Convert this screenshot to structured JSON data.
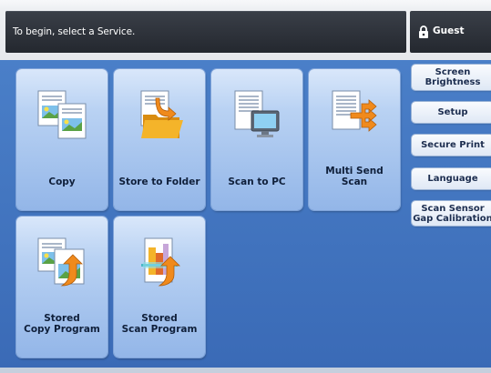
{
  "status": {
    "message": "To begin, select a Service.",
    "user_label": "Guest",
    "user_icon": "padlock-user-icon"
  },
  "services": [
    {
      "label_line1": "",
      "label_line2": "Copy",
      "icon": "copy-icon"
    },
    {
      "label_line1": "",
      "label_line2": "Store to Folder",
      "icon": "store-to-folder-icon"
    },
    {
      "label_line1": "",
      "label_line2": "Scan to PC",
      "icon": "scan-to-pc-icon"
    },
    {
      "label_line1": "Multi Send",
      "label_line2": "Scan",
      "icon": "multi-send-scan-icon"
    },
    {
      "label_line1": "Stored",
      "label_line2": "Copy Program",
      "icon": "stored-copy-program-icon"
    },
    {
      "label_line1": "Stored",
      "label_line2": "Scan Program",
      "icon": "stored-scan-program-icon"
    }
  ],
  "side_buttons": [
    {
      "line1": "Screen",
      "line2": "Brightness"
    },
    {
      "line1": "Setup",
      "line2": ""
    },
    {
      "line1": "Secure Print",
      "line2": ""
    },
    {
      "line1": "Language",
      "line2": ""
    },
    {
      "line1": "Scan Sensor",
      "line2": "Gap Calibration"
    }
  ],
  "colors": {
    "background": "#3e6db7",
    "tile": "#b9d2f3",
    "message_bar": "#2c3038",
    "folder": "#f0a81e",
    "arrow_orange": "#f08a1c"
  }
}
